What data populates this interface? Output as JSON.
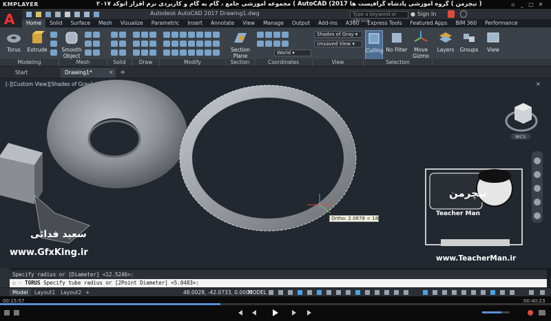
{
  "player": {
    "name": "KMPLAYER",
    "title": "مجموعه آموزشی جامع ، گام به گام و کاربردی نرم افزار  اتوکد ٢٠١٧ ( AutoCAD (2017  مدرس : سعید فدایی ( تیچرمن ) گروه آموزشی پادشاه گرافیست ها",
    "time_elapsed": "00:15:57",
    "time_total": "00:40:23",
    "progress": 0.4
  },
  "app": {
    "doc_title": "Autodesk AutoCAD 2017    Drawing1.dwg",
    "search_placeholder": "Type a keyword or phrase",
    "sign_in": "Sign In"
  },
  "ribbon_tabs": [
    "Home",
    "Solid",
    "Surface",
    "Mesh",
    "Visualize",
    "Parametric",
    "Insert",
    "Annotate",
    "View",
    "Manage",
    "Output",
    "Add-ins",
    "A360",
    "Express Tools",
    "Featured Apps",
    "BIM 360",
    "Performance"
  ],
  "ribbon": {
    "torus": "Torus",
    "extrude": "Extrude",
    "smooth_object": "Smooth Object",
    "section_plane": "Section Plane",
    "visual_style": "Shades of Gray",
    "view_state": "Unsaved View",
    "ucs": "World",
    "culling": "Culling",
    "no_filter": "No Filter",
    "move_gizmo": "Move Gizmo",
    "layers": "Layers",
    "groups": "Groups",
    "view": "View"
  },
  "ribbon_groups": [
    "Modeling",
    "Mesh",
    "Solid Editing",
    "Draw",
    "Modify",
    "Section",
    "Coordinates",
    "View",
    "Selection"
  ],
  "file_tabs": {
    "start": "Start",
    "drawing": "Drawing1*"
  },
  "viewport": {
    "label": "[-][Custom View][Shades of Gray]",
    "ortho_tooltip": "Ortho: 2.0678 < 180°",
    "wcs": "WCS"
  },
  "command": {
    "history": "Specify radius or [Diameter] <12.5246>:",
    "prompt_cmd": "TORUS",
    "prompt_text": "Specify tube radius or [2Point Diameter] <5.0483>:"
  },
  "status": {
    "layout_tabs": [
      "Model",
      "Layout1",
      "Layout2"
    ],
    "coordinates": "48.0028, -42.0733, 0.0000",
    "mode": "MODEL"
  },
  "watermarks": {
    "gfx_url": "www.GfxKing.ir",
    "gfx_name": "سعید فدائی",
    "teacher_url": "www.TeacherMan.ir",
    "teacher_name": "Teacher Man",
    "teacher_logo": "تیچرمن"
  }
}
